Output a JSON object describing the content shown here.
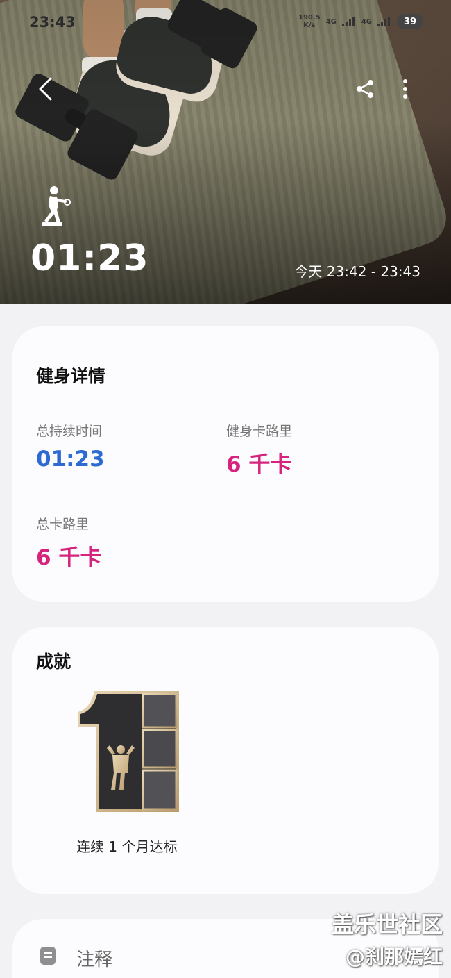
{
  "status_bar": {
    "time": "23:43",
    "net_speed": "190.5",
    "net_unit": "K/s",
    "net_type_1": "4G",
    "net_type_2": "4G",
    "battery": "39"
  },
  "header": {
    "duration": "01:23",
    "time_range": "今天 23:42 - 23:43",
    "icons": [
      "back-icon",
      "share-icon",
      "more-icon",
      "workout-icon"
    ]
  },
  "details": {
    "title": "健身详情",
    "metrics": [
      {
        "label": "总持续时间",
        "value": "01:23",
        "color": "#2d6bd2"
      },
      {
        "label": "健身卡路里",
        "value": "6 千卡",
        "color": "#d6247e"
      },
      {
        "label": "总卡路里",
        "value": "6 千卡",
        "color": "#d6247e"
      }
    ]
  },
  "achievements": {
    "title": "成就",
    "badge_label": "连续 1 个月达标"
  },
  "notes": {
    "label": "注释"
  },
  "watermark": {
    "line1": "盖乐世社区",
    "line2": "@刹那嫣红"
  }
}
